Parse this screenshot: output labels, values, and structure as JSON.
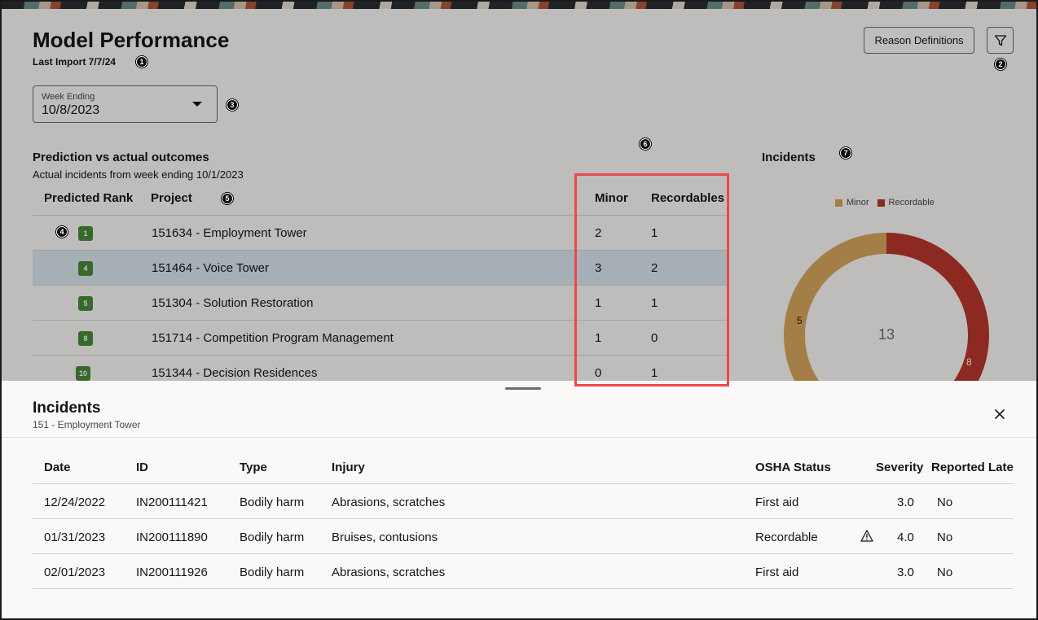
{
  "header": {
    "title": "Model Performance",
    "last_import": "Last Import 7/7/24",
    "reason_button": "Reason Definitions",
    "filter_icon": "filter-icon"
  },
  "week_select": {
    "label": "Week Ending",
    "value": "10/8/2023"
  },
  "prediction": {
    "title": "Prediction vs actual outcomes",
    "subtitle": "Actual incidents from week ending 10/1/2023",
    "columns": {
      "rank": "Predicted Rank",
      "project": "Project",
      "minor": "Minor",
      "recordables": "Recordables"
    },
    "rows": [
      {
        "rank": "1",
        "project": "151634 - Employment Tower",
        "minor": "2",
        "recordables": "1"
      },
      {
        "rank": "4",
        "project": "151464 - Voice Tower",
        "minor": "3",
        "recordables": "2"
      },
      {
        "rank": "5",
        "project": "151304 - Solution Restoration",
        "minor": "1",
        "recordables": "1"
      },
      {
        "rank": "8",
        "project": "151714 - Competition Program Management",
        "minor": "1",
        "recordables": "0"
      },
      {
        "rank": "10",
        "project": "151344 - Decision Residences",
        "minor": "0",
        "recordables": "1"
      }
    ]
  },
  "incidents_chart": {
    "title": "Incidents",
    "legend": [
      "Minor",
      "Recordable"
    ],
    "total": "13",
    "minor_label": "5",
    "recordable_label": "8",
    "colors": {
      "minor": "#d6a65c",
      "recordable": "#b8362b"
    }
  },
  "callouts": [
    "1",
    "2",
    "3",
    "4",
    "5",
    "6",
    "7"
  ],
  "drawer": {
    "title": "Incidents",
    "subtitle": "151 - Employment Tower",
    "columns": {
      "date": "Date",
      "id": "ID",
      "type": "Type",
      "injury": "Injury",
      "osha": "OSHA Status",
      "severity": "Severity",
      "late": "Reported Late"
    },
    "rows": [
      {
        "date": "12/24/2022",
        "id": "IN200111421",
        "type": "Bodily harm",
        "injury": "Abrasions, scratches",
        "osha": "First aid",
        "severity": "3.0",
        "late": "No"
      },
      {
        "date": "01/31/2023",
        "id": "IN200111890",
        "type": "Bodily harm",
        "injury": "Bruises, contusions",
        "osha": "Recordable",
        "severity": "4.0",
        "late": "No"
      },
      {
        "date": "02/01/2023",
        "id": "IN200111926",
        "type": "Bodily harm",
        "injury": "Abrasions, scratches",
        "osha": "First aid",
        "severity": "3.0",
        "late": "No"
      }
    ]
  }
}
